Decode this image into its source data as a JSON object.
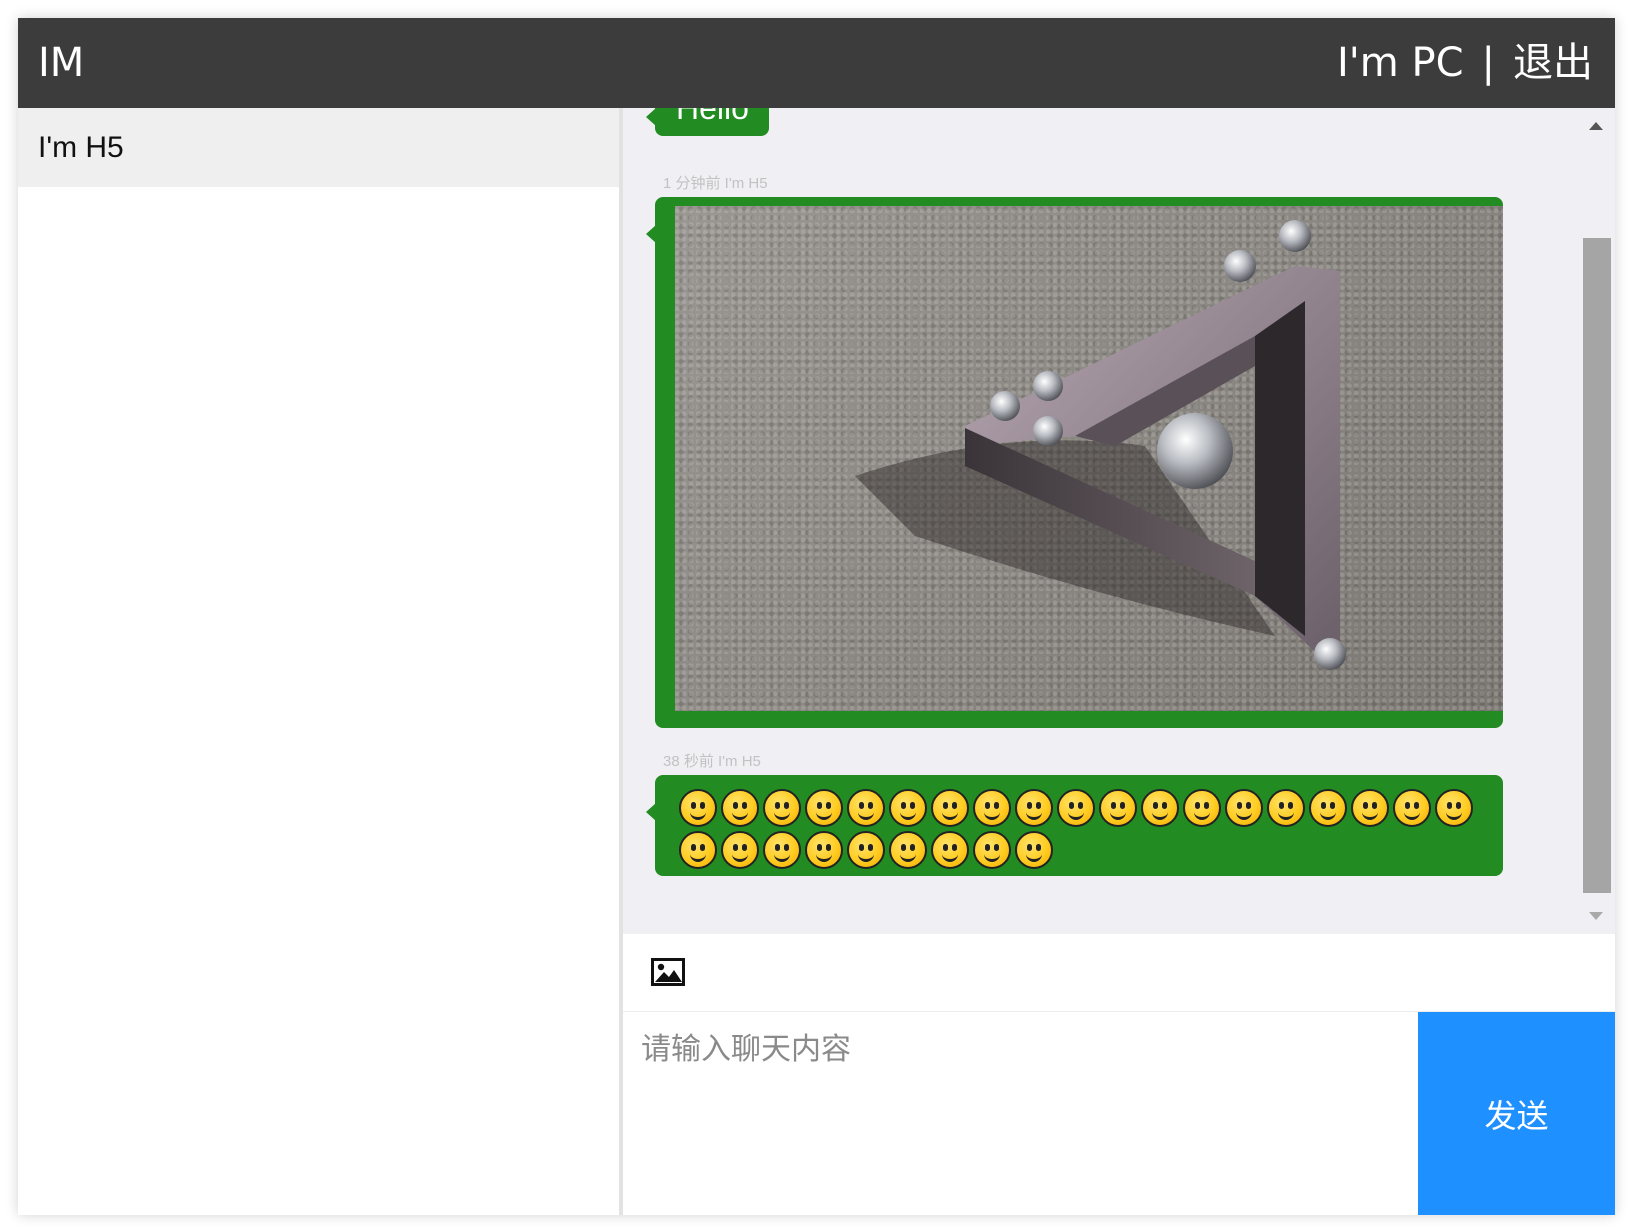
{
  "header": {
    "brand": "IM",
    "user_name": "I'm PC",
    "separator": "|",
    "logout_label": "退出"
  },
  "sidebar": {
    "contacts": [
      {
        "name": "I'm H5"
      }
    ]
  },
  "messages": [
    {
      "type": "text",
      "text": "Hello"
    },
    {
      "type": "image",
      "meta": "1 分钟前 I'm H5"
    },
    {
      "type": "emoji",
      "meta": "38 秒前 I'm H5",
      "emoji_count": 29
    }
  ],
  "composer": {
    "placeholder": "请输入聊天内容",
    "send_label": "发送"
  },
  "colors": {
    "header_bg": "#3c3c3c",
    "bubble": "#228b22",
    "send_button": "#1e90ff",
    "chat_bg": "#f0eff4"
  }
}
